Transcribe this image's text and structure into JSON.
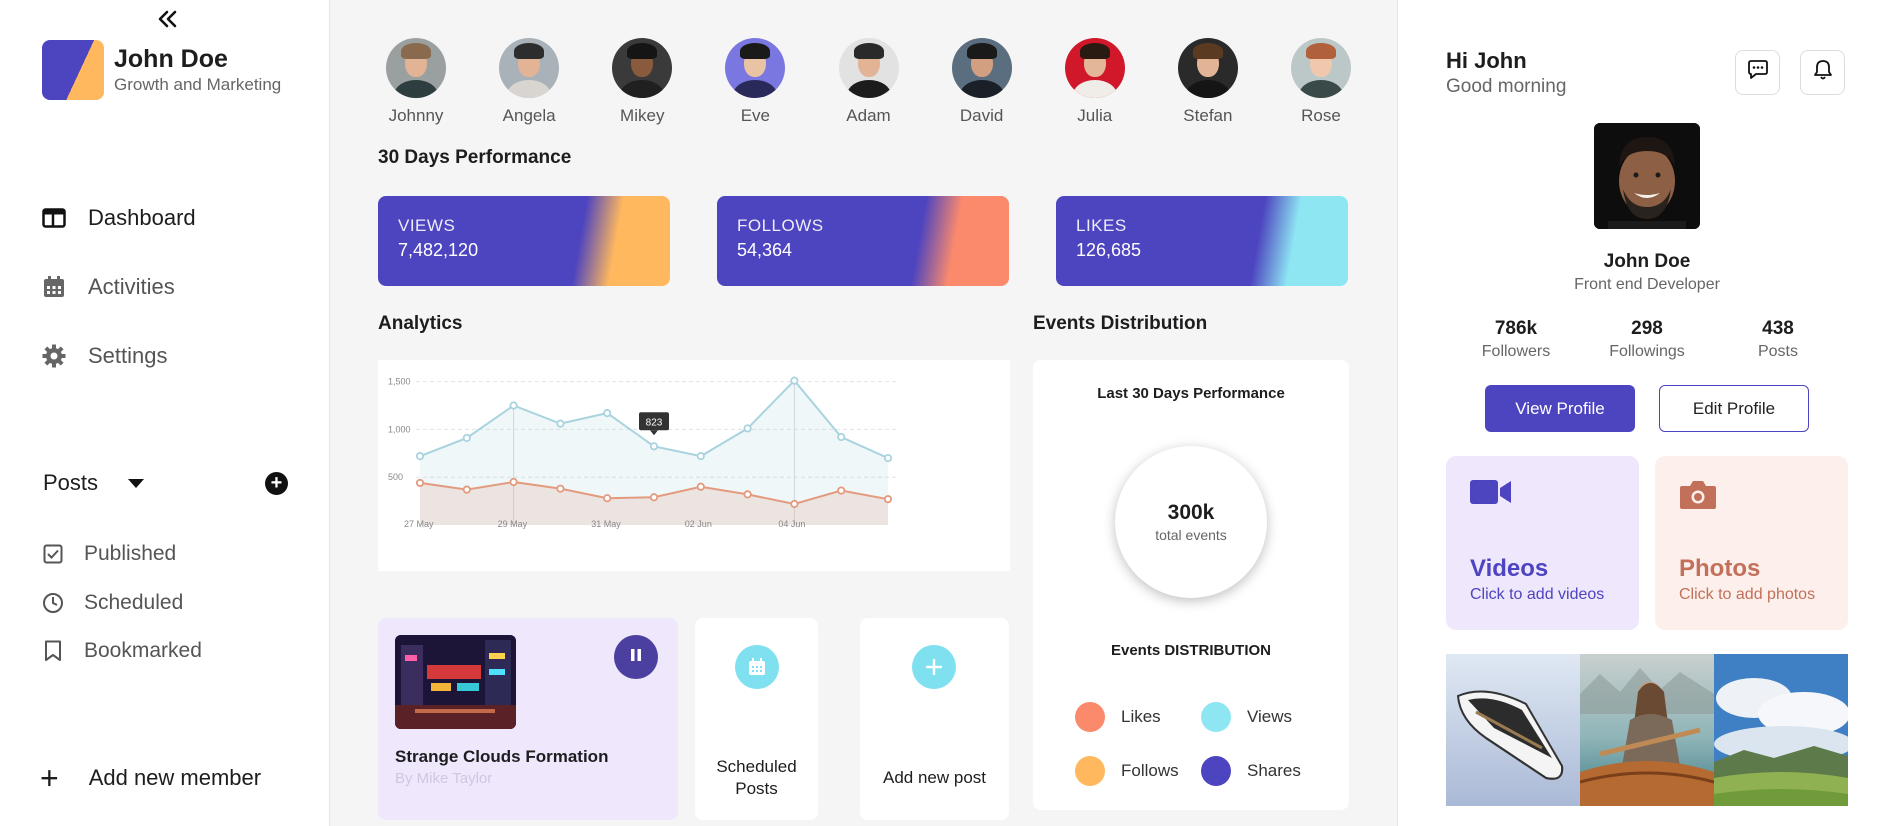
{
  "sidebar": {
    "brand": {
      "name": "John Doe",
      "role": "Growth and Marketing",
      "colors": [
        "#4d44bf",
        "#ffb85e"
      ]
    },
    "nav": [
      {
        "label": "Dashboard",
        "icon": "dashboard-icon"
      },
      {
        "label": "Activities",
        "icon": "calendar-icon"
      },
      {
        "label": "Settings",
        "icon": "gear-icon"
      }
    ],
    "posts": {
      "label": "Posts",
      "items": [
        {
          "label": "Published",
          "icon": "checkbox-icon"
        },
        {
          "label": "Scheduled",
          "icon": "clock-icon"
        },
        {
          "label": "Bookmarked",
          "icon": "bookmark-icon"
        }
      ]
    },
    "add_member": "Add new member"
  },
  "people": [
    {
      "name": "Johnny"
    },
    {
      "name": "Angela"
    },
    {
      "name": "Mikey"
    },
    {
      "name": "Eve"
    },
    {
      "name": "Adam"
    },
    {
      "name": "David"
    },
    {
      "name": "Julia"
    },
    {
      "name": "Stefan"
    },
    {
      "name": "Rose"
    }
  ],
  "performance": {
    "title": "30 Days Performance",
    "cards": [
      {
        "label": "VIEWS",
        "value": "7,482,120",
        "accent": "#ffb85e"
      },
      {
        "label": "FOLLOWS",
        "value": "54,364",
        "accent": "#fb8a6d"
      },
      {
        "label": "LIKES",
        "value": "126,685",
        "accent": "#8ee6f3"
      }
    ],
    "base_color": "#4d44bf"
  },
  "analytics": {
    "title": "Analytics",
    "chart_data": {
      "type": "area",
      "x_ticks": [
        "27 May",
        "29 May",
        "31 May",
        "02 Jun",
        "04 Jun"
      ],
      "y_ticks": [
        "1,500",
        "1,000",
        "500"
      ],
      "ylim": [
        0,
        1600
      ],
      "tooltip": "823",
      "series": [
        {
          "values": [
            720,
            910,
            1250,
            1060,
            1170,
            823,
            720,
            1010,
            1510,
            920,
            700
          ],
          "color": "#a9d3de"
        },
        {
          "values": [
            440,
            370,
            450,
            380,
            280,
            290,
            400,
            320,
            220,
            360,
            270
          ],
          "color": "#e39a7e"
        }
      ]
    }
  },
  "events": {
    "title": "Events Distribution",
    "subtitle": "Last 30 Days Performance",
    "total_value": "300k",
    "total_label": "total events",
    "dist_title": "Events DISTRIBUTION",
    "legend": [
      {
        "label": "Likes",
        "color": "#fb8a6d"
      },
      {
        "label": "Views",
        "color": "#8ee6f3"
      },
      {
        "label": "Follows",
        "color": "#ffb85e"
      },
      {
        "label": "Shares",
        "color": "#4d44bf"
      }
    ]
  },
  "now_playing": {
    "title": "Strange Clouds Formation",
    "author": "By Mike Taylor"
  },
  "quick_actions": [
    {
      "label_line1": "Scheduled",
      "label_line2": "Posts",
      "icon": "calendar-icon"
    },
    {
      "label_line1": "Add new post",
      "label_line2": "",
      "icon": "plus-icon"
    }
  ],
  "profile": {
    "greeting": "Hi John",
    "greeting_sub": "Good morning",
    "name": "John Doe",
    "role": "Front end Developer",
    "stats": [
      {
        "value": "786k",
        "label": "Followers"
      },
      {
        "value": "298",
        "label": "Followings"
      },
      {
        "value": "438",
        "label": "Posts"
      }
    ],
    "view_profile": "View Profile",
    "edit_profile": "Edit Profile"
  },
  "media": [
    {
      "title": "Videos",
      "subtitle": "Click to add videos",
      "icon": "video-camera-icon",
      "bg": "#efe8fd",
      "color": "#4d44bf"
    },
    {
      "title": "Photos",
      "subtitle": "Click to add photos",
      "icon": "camera-icon",
      "bg": "#fdf0ec",
      "color": "#c2705a"
    }
  ]
}
